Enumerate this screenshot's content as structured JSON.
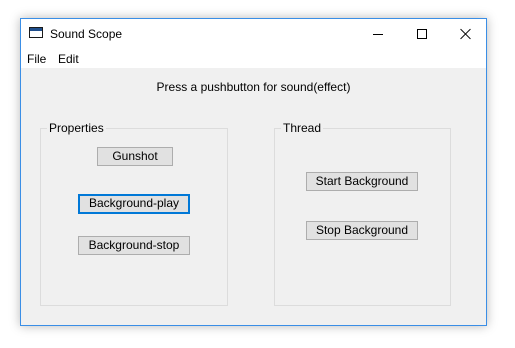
{
  "window": {
    "title": "Sound Scope"
  },
  "menu": {
    "items": [
      "File",
      "Edit"
    ]
  },
  "instruction": "Press a pushbutton for sound(effect)",
  "groups": {
    "properties": {
      "label": "Properties",
      "buttons": [
        "Gunshot",
        "Background-play",
        "Background-stop"
      ]
    },
    "thread": {
      "label": "Thread",
      "buttons": [
        "Start Background",
        "Stop Background"
      ]
    }
  },
  "focused_button": "Background-play",
  "icons": {
    "app": "app-window-icon",
    "minimize": "minimize-icon",
    "maximize": "maximize-icon",
    "close": "close-icon"
  },
  "colors": {
    "window_border": "#3a8ee6",
    "client_bg": "#f0f0f0",
    "button_bg": "#e1e1e1",
    "focus_border": "#0078d7"
  }
}
